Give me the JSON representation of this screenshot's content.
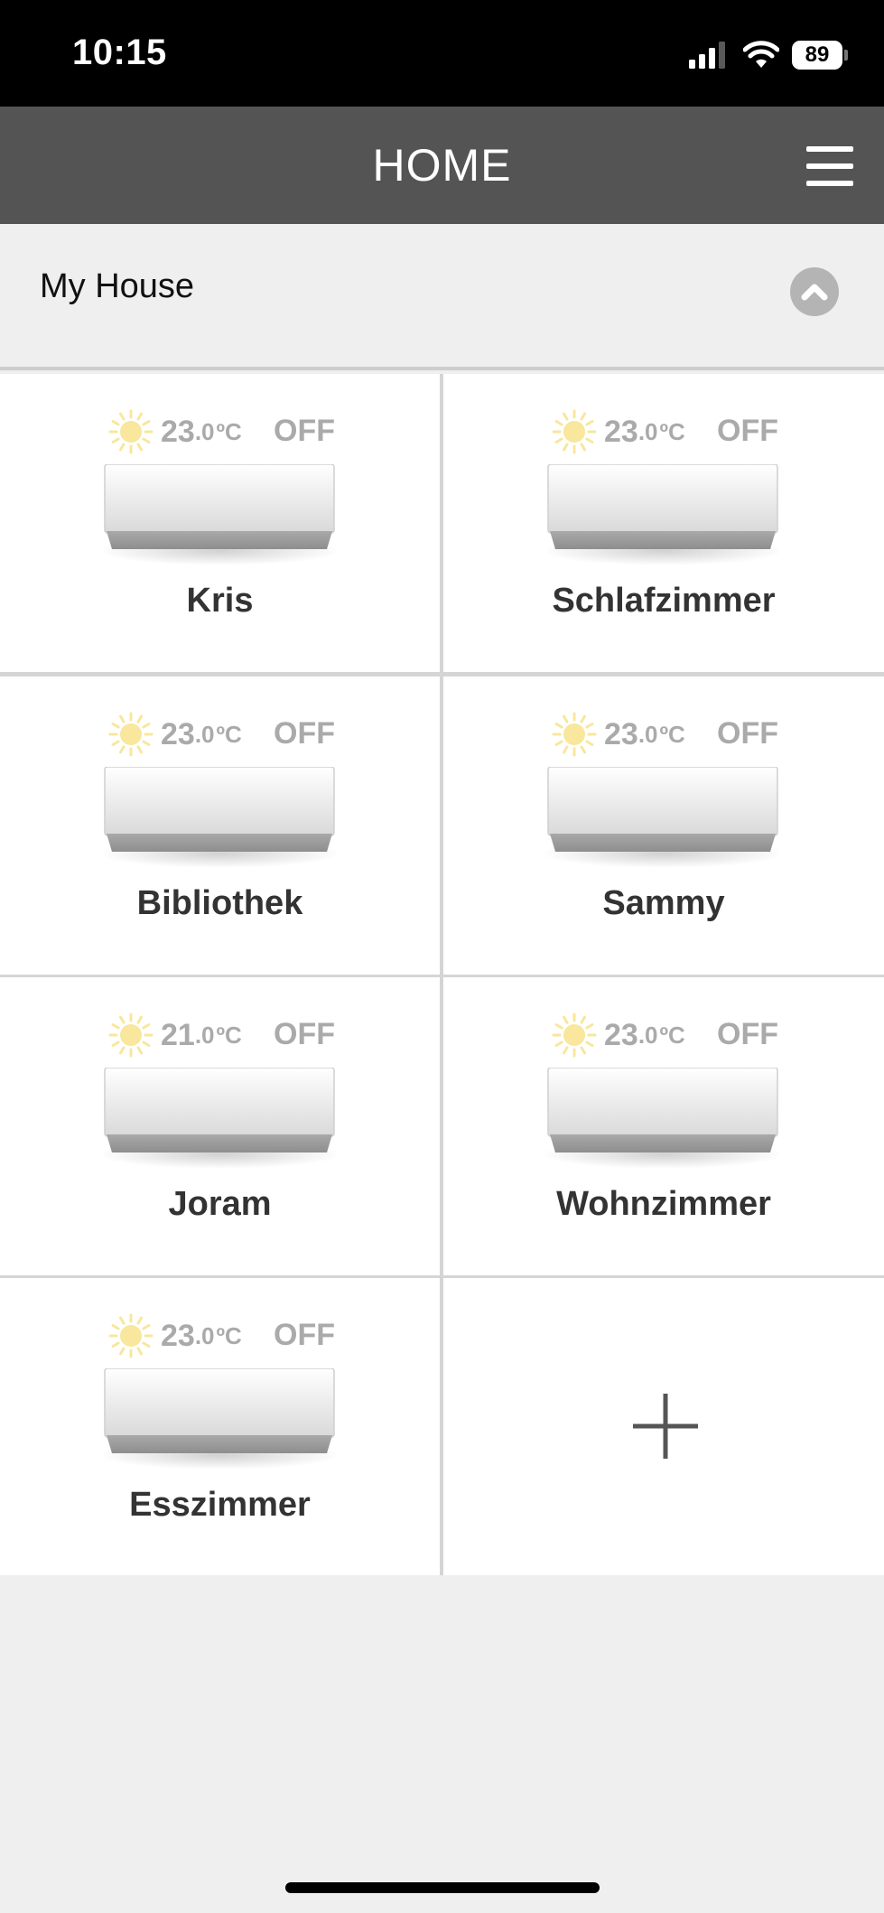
{
  "status_bar": {
    "time": "10:15",
    "battery": "89"
  },
  "header": {
    "title": "HOME"
  },
  "house": {
    "name": "My House"
  },
  "units": [
    {
      "name": "Kris",
      "temp_int": "23",
      "temp_dec": ".0",
      "unit": "ºC",
      "power": "OFF"
    },
    {
      "name": "Schlafzimmer",
      "temp_int": "23",
      "temp_dec": ".0",
      "unit": "ºC",
      "power": "OFF"
    },
    {
      "name": "Bibliothek",
      "temp_int": "23",
      "temp_dec": ".0",
      "unit": "ºC",
      "power": "OFF"
    },
    {
      "name": "Sammy",
      "temp_int": "23",
      "temp_dec": ".0",
      "unit": "ºC",
      "power": "OFF"
    },
    {
      "name": "Joram",
      "temp_int": "21",
      "temp_dec": ".0",
      "unit": "ºC",
      "power": "OFF"
    },
    {
      "name": "Wohnzimmer",
      "temp_int": "23",
      "temp_dec": ".0",
      "unit": "ºC",
      "power": "OFF"
    },
    {
      "name": "Esszimmer",
      "temp_int": "23",
      "temp_dec": ".0",
      "unit": "ºC",
      "power": "OFF"
    }
  ],
  "icons": {
    "mode": "sun-icon",
    "add": "plus-icon",
    "menu": "hamburger-icon",
    "collapse": "chevron-up-icon"
  },
  "colors": {
    "header_bg": "#545454",
    "sun": "#f8e79c",
    "muted_text": "#aaaaaa"
  }
}
